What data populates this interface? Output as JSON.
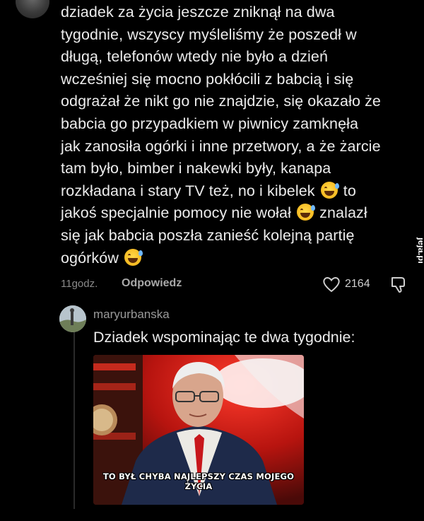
{
  "comment": {
    "lines": [
      "dziadek za życia jeszcze zniknął na dwa",
      "tygodnie, wszyscy myśleliśmy że poszedł w",
      "długą, telefonów wtedy nie było a dzień",
      "wcześniej się mocno pokłócili z babcią i się",
      "odgrażał że nikt go nie znajdzie, się okazało że",
      "babcia go przypadkiem w piwnicy zamknęła",
      "jak zanosiła ogórki i inne przetwory, a że żarcie",
      "tam było, bimber i nakewki były, kanapa",
      "rozkładana i stary TV też, no i kibelek",
      "to",
      "jakoś specjalnie pomocy nie wołał",
      "znalazł",
      "się jak babcia poszła zanieść kolejną partię",
      "ogórków"
    ],
    "time": "11godz.",
    "reply_label": "Odpowiedz",
    "likes": "2164"
  },
  "reply": {
    "username": "maryurbanska",
    "text": "Dziadek wspominając te dwa tygodnie:",
    "media_caption": "TO BYŁ CHYBA NAJLEPSZY CZAS MOJEGO ŻYCIA"
  },
  "watermark": {
    "text": "jeja.pl"
  },
  "colors": {
    "background": "#000000",
    "text": "#ececec",
    "muted": "#8a8a8a"
  }
}
